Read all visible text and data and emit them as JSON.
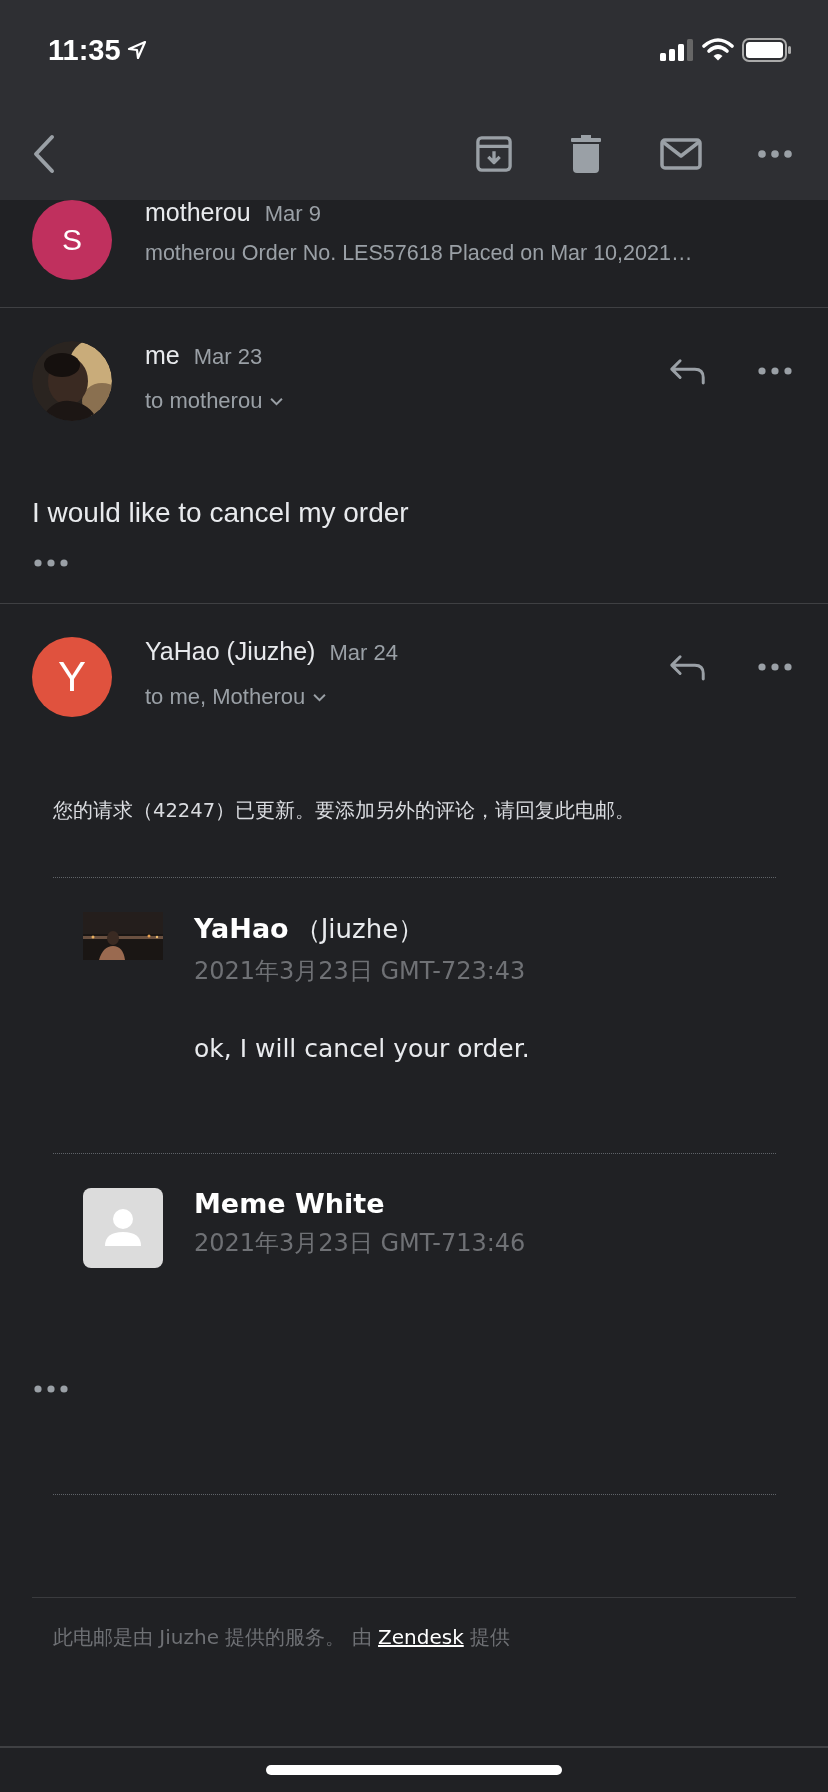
{
  "status_bar": {
    "time": "11:35"
  },
  "messages": [
    {
      "kind": "collapsed",
      "avatar": {
        "kind": "letter",
        "letter": "S",
        "color": "#c0305e"
      },
      "sender": "motherou",
      "date": "Mar 9",
      "snippet": "motherou Order No. LES57618 Placed on Mar 10,2021…"
    },
    {
      "kind": "plain",
      "sender": "me",
      "date": "Mar 23",
      "recipients": "to motherou",
      "body": "I would like to cancel my order"
    },
    {
      "kind": "ticket",
      "avatar": {
        "kind": "letter",
        "letter": "Y",
        "color": "#e0523e"
      },
      "sender": "YaHao (Jiuzhe)",
      "date": "Mar 24",
      "recipients": "to me, Motherou"
    }
  ],
  "ticket": {
    "notice": "您的请求（42247）已更新。要添加另外的评论，请回复此电邮。",
    "comments": [
      {
        "author": "YaHao",
        "organization": "（Jiuzhe）",
        "time": "2021年3月23日 GMT-723:43",
        "text": "ok, I will cancel your order."
      },
      {
        "avatar": {
          "kind": "placeholder"
        },
        "author": "Meme White",
        "time": "2021年3月23日 GMT-713:46"
      }
    ],
    "footer": {
      "before": "此电邮是由 Jiuzhe 提供的服务。 由 ",
      "link": "Zendesk",
      "after": " 提供"
    }
  }
}
